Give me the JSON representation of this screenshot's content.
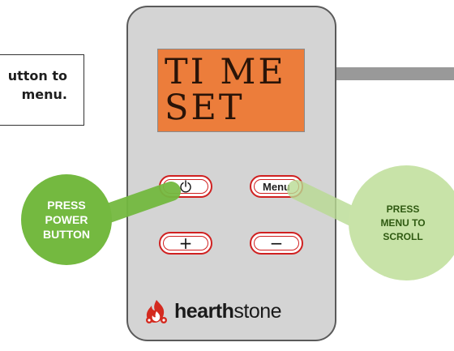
{
  "instruction_box": {
    "line1": "utton to",
    "line2": "menu."
  },
  "display": {
    "line1": "TI ME",
    "line2": "SET"
  },
  "buttons": {
    "power_icon": "power-icon",
    "menu_label": "Menu",
    "plus_glyph": "+",
    "minus_glyph": "−"
  },
  "callouts": {
    "power": {
      "line1": "PRESS",
      "line2": "POWER",
      "line3": "BUTTON"
    },
    "menu": {
      "line1": "PRESS",
      "line2": "MENU TO",
      "line3": "SCROLL"
    }
  },
  "logo": {
    "text_bold": "hearth",
    "text_light": "stone"
  },
  "colors": {
    "lcd": "#ec7d3b",
    "button_ring": "#d02020",
    "callout_power": "#74b940",
    "callout_menu": "#c8e3a8",
    "remote_body": "#d4d4d4",
    "logo_flame": "#d42a1f"
  }
}
